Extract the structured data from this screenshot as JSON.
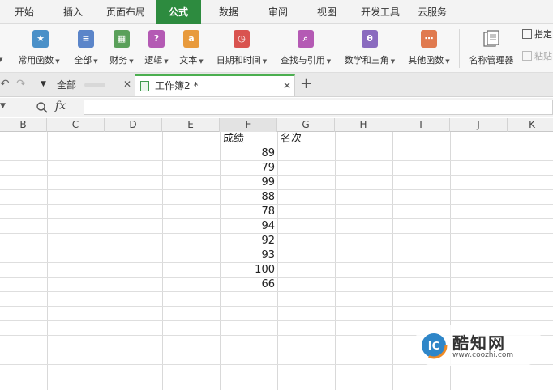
{
  "menu": {
    "tabs": [
      "开始",
      "插入",
      "页面布局",
      "公式",
      "数据",
      "审阅",
      "视图",
      "开发工具",
      "云服务"
    ],
    "active": "公式"
  },
  "ribbon": {
    "left_cut_label": "田",
    "buttons": [
      {
        "label": "常用函数",
        "icon": "star-icon",
        "color": "#4a90c8"
      },
      {
        "label": "全部",
        "icon": "list-icon",
        "color": "#5b85c9"
      },
      {
        "label": "财务",
        "icon": "finance-icon",
        "color": "#5aa05a"
      },
      {
        "label": "逻辑",
        "icon": "question-icon",
        "color": "#b45ab4"
      },
      {
        "label": "文本",
        "icon": "text-a-icon",
        "color": "#e89a3c"
      },
      {
        "label": "日期和时间",
        "icon": "clock-icon",
        "color": "#d9534f"
      },
      {
        "label": "查找与引用",
        "icon": "magnifier-icon",
        "color": "#b45ab4"
      },
      {
        "label": "数学和三角",
        "icon": "theta-icon",
        "color": "#8a6bbf"
      },
      {
        "label": "其他函数",
        "icon": "more-icon",
        "color": "#e07a4f"
      }
    ],
    "name_manager": "名称管理器",
    "specify_label": "指定",
    "paste_label": "粘贴"
  },
  "doc_tabs": {
    "all_label": "全部",
    "workbook_label": "工作簿2 *",
    "add_label": "+"
  },
  "formula_bar": {
    "fx_label": "fx",
    "value": ""
  },
  "columns": [
    "B",
    "C",
    "D",
    "E",
    "F",
    "G",
    "H",
    "I",
    "J",
    "K"
  ],
  "sheet": {
    "header_f": "成绩",
    "header_g": "名次",
    "scores": [
      "89",
      "79",
      "99",
      "88",
      "78",
      "94",
      "92",
      "93",
      "100",
      "66"
    ]
  },
  "watermark": {
    "brand": "酷知网",
    "url": "www.coozhi.com"
  }
}
